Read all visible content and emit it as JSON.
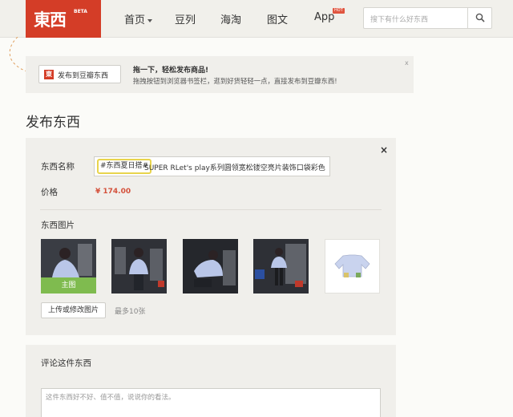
{
  "logo": {
    "text": "東西",
    "beta": "BETA"
  },
  "nav": {
    "home": "首页",
    "douban": "豆列",
    "haitao": "海淘",
    "tuwen": "图文",
    "app": "App",
    "hot": "HOT"
  },
  "search": {
    "placeholder": "搜下有什么好东西"
  },
  "banner": {
    "button_label": "发布到豆瓣东西",
    "button_icon_text": "東",
    "title": "拖一下，轻松发布商品!",
    "description": "拖拽按钮到浏览器书签栏，逛到好货轻轻一点，直接发布到豆瓣东西!",
    "close": "x"
  },
  "page_title": "发布东西",
  "form": {
    "close": "×",
    "name_label": "东西名称",
    "name_tag": "#东西夏日搭#",
    "name_value": "SUPER RLet's play系列圆领宽松镂空亮片装饰口袋彩色",
    "price_label": "价格",
    "price_value": "¥ 174.00",
    "images_label": "东西图片",
    "main_badge": "主图",
    "upload_button": "上传或修改图片",
    "max_note": "最多10张"
  },
  "comment": {
    "label": "评论这件东西",
    "placeholder": "这件东西好不好、值不值，说说你的看法。"
  },
  "colors": {
    "brand_red": "#d43d27",
    "main_badge_green": "#7fbb4f",
    "price_red": "#d4513b",
    "tag_highlight": "#e8d44d"
  }
}
